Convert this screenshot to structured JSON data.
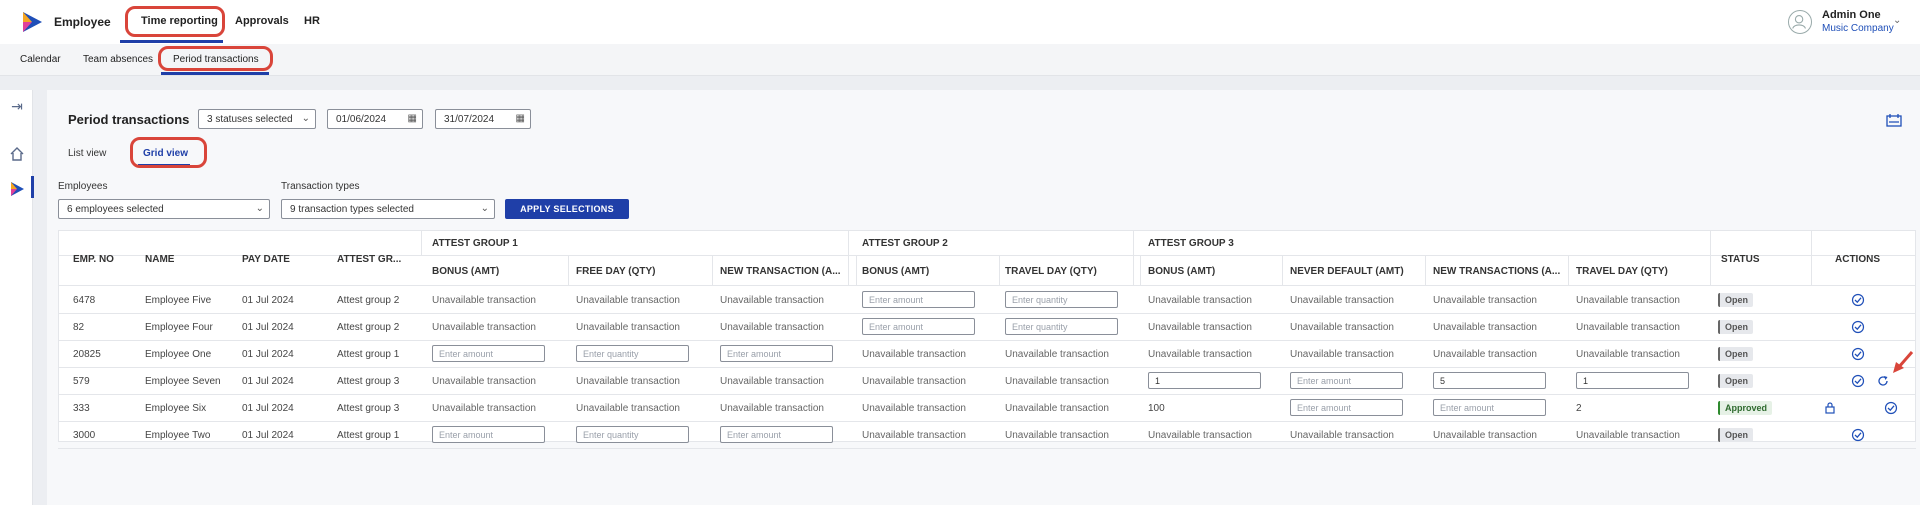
{
  "header": {
    "app_name": "Employee",
    "nav": [
      "Time reporting",
      "Approvals",
      "HR"
    ],
    "user": {
      "name": "Admin One",
      "company": "Music Company"
    }
  },
  "subnav": [
    "Calendar",
    "Team absences",
    "Period transactions"
  ],
  "page": {
    "title": "Period transactions",
    "status_filter": "3 statuses selected",
    "date_from": "01/06/2024",
    "date_to": "31/07/2024",
    "tabs": [
      "List view",
      "Grid view"
    ]
  },
  "filters": {
    "employees_label": "Employees",
    "employees_value": "6 employees selected",
    "types_label": "Transaction types",
    "types_value": "9 transaction types selected",
    "apply_label": "APPLY SELECTIONS"
  },
  "table": {
    "headers": {
      "emp_no": "EMP. NO",
      "name": "NAME",
      "pay_date": "PAY DATE",
      "attest": "ATTEST GR...",
      "group1": "ATTEST GROUP 1",
      "group2": "ATTEST GROUP 2",
      "group3": "ATTEST GROUP 3",
      "status": "STATUS",
      "actions": "ACTIONS",
      "cols": [
        "BONUS (AMT)",
        "FREE DAY (QTY)",
        "NEW TRANSACTION (A...",
        "BONUS (AMT)",
        "TRAVEL DAY (QTY)",
        "BONUS (AMT)",
        "NEVER DEFAULT (AMT)",
        "NEW TRANSACTIONS (A...",
        "TRAVEL DAY (QTY)"
      ]
    },
    "unavailable": "Unavailable transaction",
    "ph_amount": "Enter amount",
    "ph_quantity": "Enter quantity",
    "rows": [
      {
        "emp_no": "6478",
        "name": "Employee Five",
        "pay_date": "01 Jul 2024",
        "attest": "Attest group 2",
        "status": "Open"
      },
      {
        "emp_no": "82",
        "name": "Employee Four",
        "pay_date": "01 Jul 2024",
        "attest": "Attest group 2",
        "status": "Open"
      },
      {
        "emp_no": "20825",
        "name": "Employee One",
        "pay_date": "01 Jul 2024",
        "attest": "Attest group 1",
        "status": "Open"
      },
      {
        "emp_no": "579",
        "name": "Employee Seven",
        "pay_date": "01 Jul 2024",
        "attest": "Attest group 3",
        "status": "Open",
        "vals": [
          "1",
          "5",
          "1"
        ]
      },
      {
        "emp_no": "333",
        "name": "Employee Six",
        "pay_date": "01 Jul 2024",
        "attest": "Attest group 3",
        "status": "Approved",
        "vals": [
          "100",
          "2"
        ]
      },
      {
        "emp_no": "3000",
        "name": "Employee Two",
        "pay_date": "01 Jul 2024",
        "attest": "Attest group 1",
        "status": "Open"
      }
    ]
  },
  "colors": {
    "accent": "#1f3fa8",
    "highlight": "#d9453a",
    "approved": "#2e8a2e"
  },
  "icons": [
    "logo-icon",
    "avatar-icon",
    "chevron-down-icon",
    "calendar-icon",
    "collapse-icon",
    "home-icon",
    "app-icon",
    "settings-icon",
    "check-circle-icon",
    "lock-icon",
    "refresh-icon"
  ]
}
